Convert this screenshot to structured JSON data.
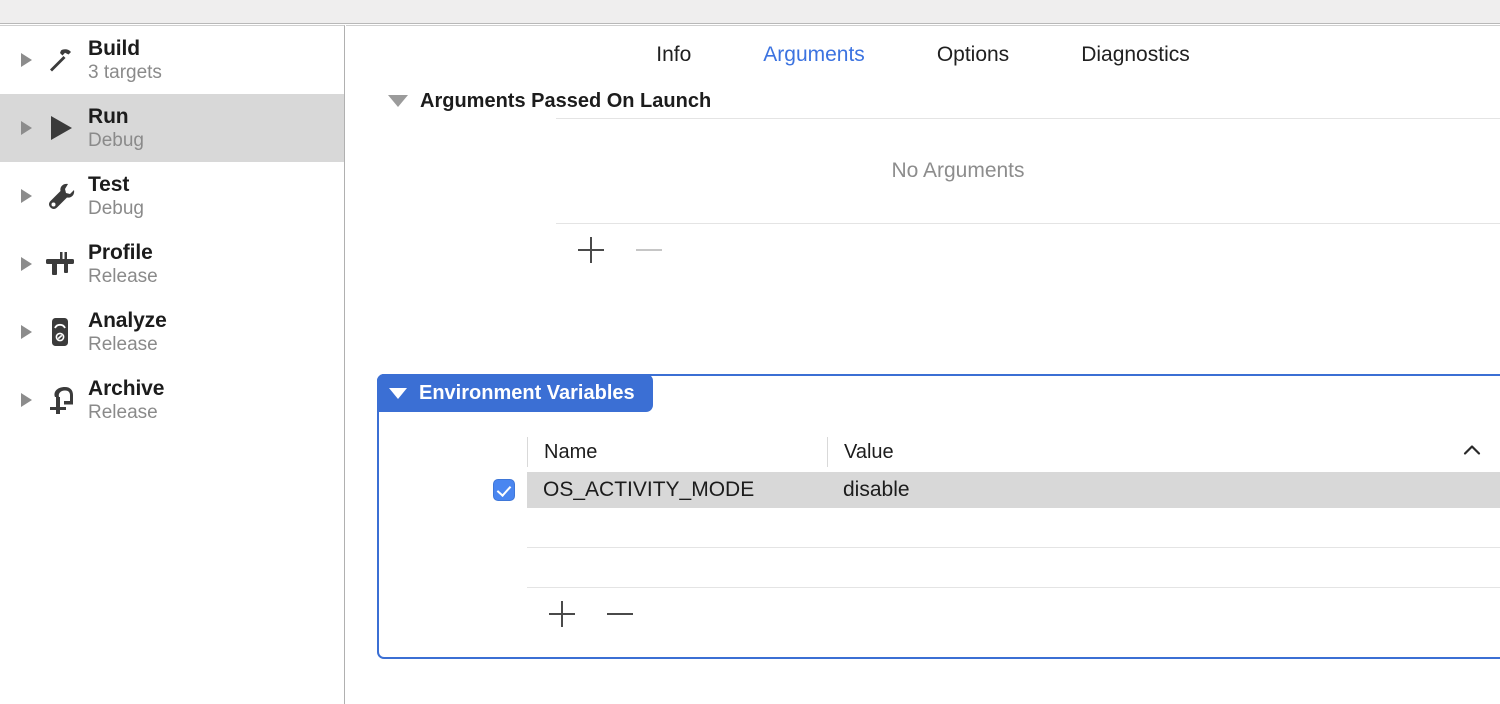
{
  "sidebar": {
    "items": [
      {
        "title": "Build",
        "subtitle": "3 targets",
        "icon": "hammer-icon",
        "selected": false
      },
      {
        "title": "Run",
        "subtitle": "Debug",
        "icon": "play-icon",
        "selected": true
      },
      {
        "title": "Test",
        "subtitle": "Debug",
        "icon": "wrench-icon",
        "selected": false
      },
      {
        "title": "Profile",
        "subtitle": "Release",
        "icon": "caliper-icon",
        "selected": false
      },
      {
        "title": "Analyze",
        "subtitle": "Release",
        "icon": "gauge-icon",
        "selected": false
      },
      {
        "title": "Archive",
        "subtitle": "Release",
        "icon": "clamp-icon",
        "selected": false
      }
    ]
  },
  "tabs": [
    {
      "label": "Info",
      "active": false
    },
    {
      "label": "Arguments",
      "active": true
    },
    {
      "label": "Options",
      "active": false
    },
    {
      "label": "Diagnostics",
      "active": false
    }
  ],
  "arguments_section": {
    "title": "Arguments Passed On Launch",
    "empty_text": "No Arguments",
    "add_label": "+",
    "remove_label": "−",
    "add_enabled": true,
    "remove_enabled": false
  },
  "environment_section": {
    "title": "Environment Variables",
    "columns": {
      "name": "Name",
      "value": "Value"
    },
    "sort_indicator": "chevron-up",
    "rows": [
      {
        "enabled": true,
        "name": "OS_ACTIVITY_MODE",
        "value": "disable",
        "selected": true
      }
    ],
    "add_label": "+",
    "remove_label": "−",
    "add_enabled": true,
    "remove_enabled": true
  },
  "colors": {
    "accent_blue": "#3b6fd4",
    "tab_active_blue": "#3c73e0",
    "checkbox_blue": "#4a86f0",
    "selection_gray": "#d8d8d8",
    "chrome_gray": "#efeeee"
  }
}
